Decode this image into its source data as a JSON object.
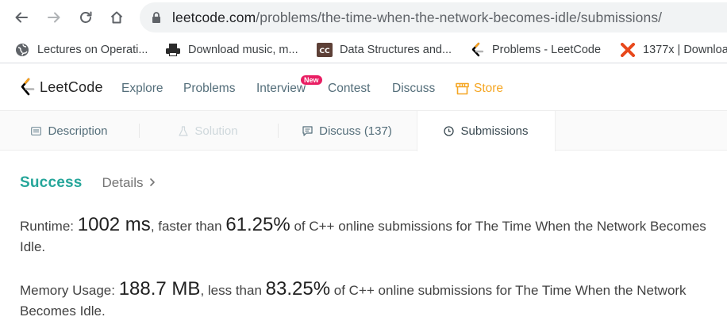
{
  "browser": {
    "url_host": "leetcode.com",
    "url_path": "/problems/the-time-when-the-network-becomes-idle/submissions/",
    "bookmarks": [
      {
        "label": "Lectures on Operati...",
        "icon": "globe-icon"
      },
      {
        "label": "Download music, m...",
        "icon": "printer-icon"
      },
      {
        "label": "Data Structures and...",
        "icon": "cc-icon"
      },
      {
        "label": "Problems - LeetCode",
        "icon": "leetcode-icon"
      },
      {
        "label": "1377x | Downloa",
        "icon": "x-logo-icon"
      }
    ]
  },
  "nav": {
    "logo_text": "LeetCode",
    "items": [
      "Explore",
      "Problems",
      "Interview",
      "Contest",
      "Discuss"
    ],
    "new_badge": "New",
    "store_label": "Store",
    "store_color": "#f5a623"
  },
  "tabs": [
    {
      "label": "Description",
      "icon": "document-icon",
      "state": "normal"
    },
    {
      "label": "Solution",
      "icon": "flask-icon",
      "state": "disabled"
    },
    {
      "label": "Discuss (137)",
      "icon": "chat-icon",
      "state": "normal"
    },
    {
      "label": "Submissions",
      "icon": "clock-icon",
      "state": "active"
    }
  ],
  "result": {
    "status": "Success",
    "status_color": "#26a69a",
    "details_label": "Details",
    "runtime": {
      "label": "Runtime: ",
      "value": "1002 ms",
      "mid": ", faster than ",
      "percent": "61.25%",
      "suffix": " of C++ online submissions for The Time When the Network Becomes Idle."
    },
    "memory": {
      "label": "Memory Usage: ",
      "value": "188.7 MB",
      "mid": ", less than ",
      "percent": "83.25%",
      "suffix": " of C++ online submissions for The Time When the Network Becomes Idle."
    }
  }
}
